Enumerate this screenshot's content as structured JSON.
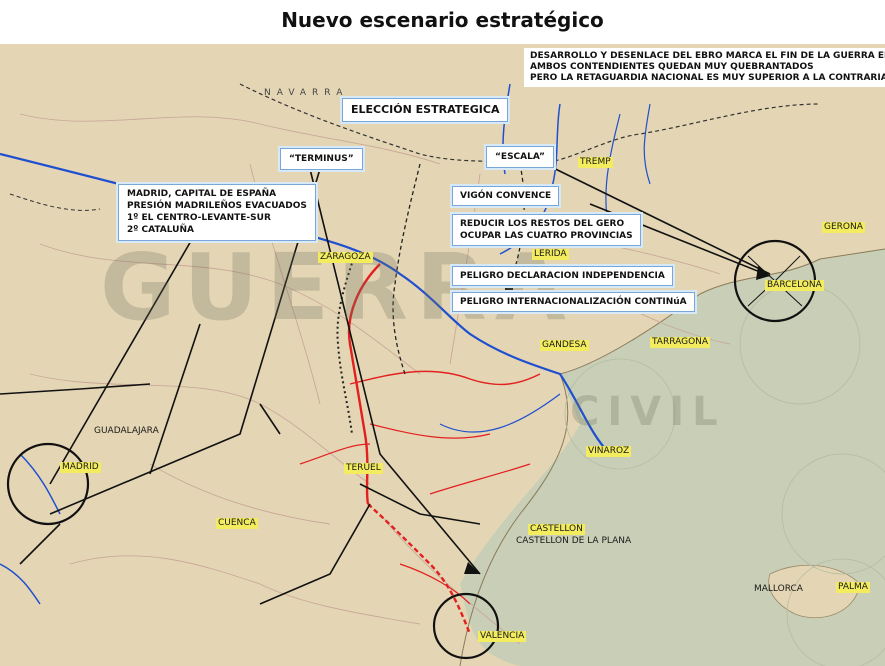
{
  "title": "Nuevo escenario estratégico",
  "header_note": {
    "line1": "DESARROLLO Y DESENLACE DEL EBRO MARCA EL FIN DE LA GUERRA EN ESPAÑA",
    "line2": "AMBOS CONTENDIENTES QUEDAN MUY QUEBRANTADOS",
    "line3": "PERO LA RETAGUARDIA NACIONAL ES MUY SUPERIOR A LA CONTRARIA"
  },
  "callouts": {
    "eleccion": "ELECCIÓN ESTRATEGICA",
    "terminus": "“TERMINUS”",
    "escala": "“ESCALA”",
    "madrid": {
      "line1": "MADRID, CAPITAL DE ESPAÑA",
      "line2": "PRESIÓN MADRILEÑOS EVACUADOS",
      "line3": "1º EL CENTRO-LEVANTE-SUR",
      "line4": "2º CATALUÑA"
    },
    "vigon": "VIGÓN CONVENCE",
    "reducir": {
      "line1": "REDUCIR LOS RESTOS DEL GERO",
      "line2": "OCUPAR LAS CUATRO PROVINCIAS"
    },
    "peligro1": "PELIGRO DECLARACION INDEPENDENCIA",
    "peligro2": "PELIGRO INTERNACIONALIZACIÓN CONTINúA"
  },
  "cities": {
    "madrid": "MADRID",
    "zaragoza": "ZARAGOZA",
    "lerida": "LERIDA",
    "barcelona": "BARCELONA",
    "tarragona": "TARRAGONA",
    "gandesa": "GANDESA",
    "teruel": "TERUEL",
    "cuenca": "CUENCA",
    "vinaroz": "VINAROZ",
    "castellon": "CASTELLON",
    "castellon_plana": "CASTELLON DE LA PLANA",
    "valencia": "VALENCIA",
    "mallorca": "MALLORCA",
    "palma": "PALMA",
    "gerona": "GERONA",
    "guadalajara": "GUADALAJARA",
    "tremp": "TREMP",
    "navarra": "NAVARRA"
  },
  "watermark": {
    "line1": "GUERRA",
    "line2": "CIVIL"
  },
  "colors": {
    "map_land": "#e4d6b4",
    "map_sea": "#c8cfb6",
    "front_red": "#e32020",
    "river_blue": "#1f4fd0",
    "arrow_black": "#111111",
    "box_border": "#7aa7d6",
    "city_highlight": "#f2ec5e"
  }
}
